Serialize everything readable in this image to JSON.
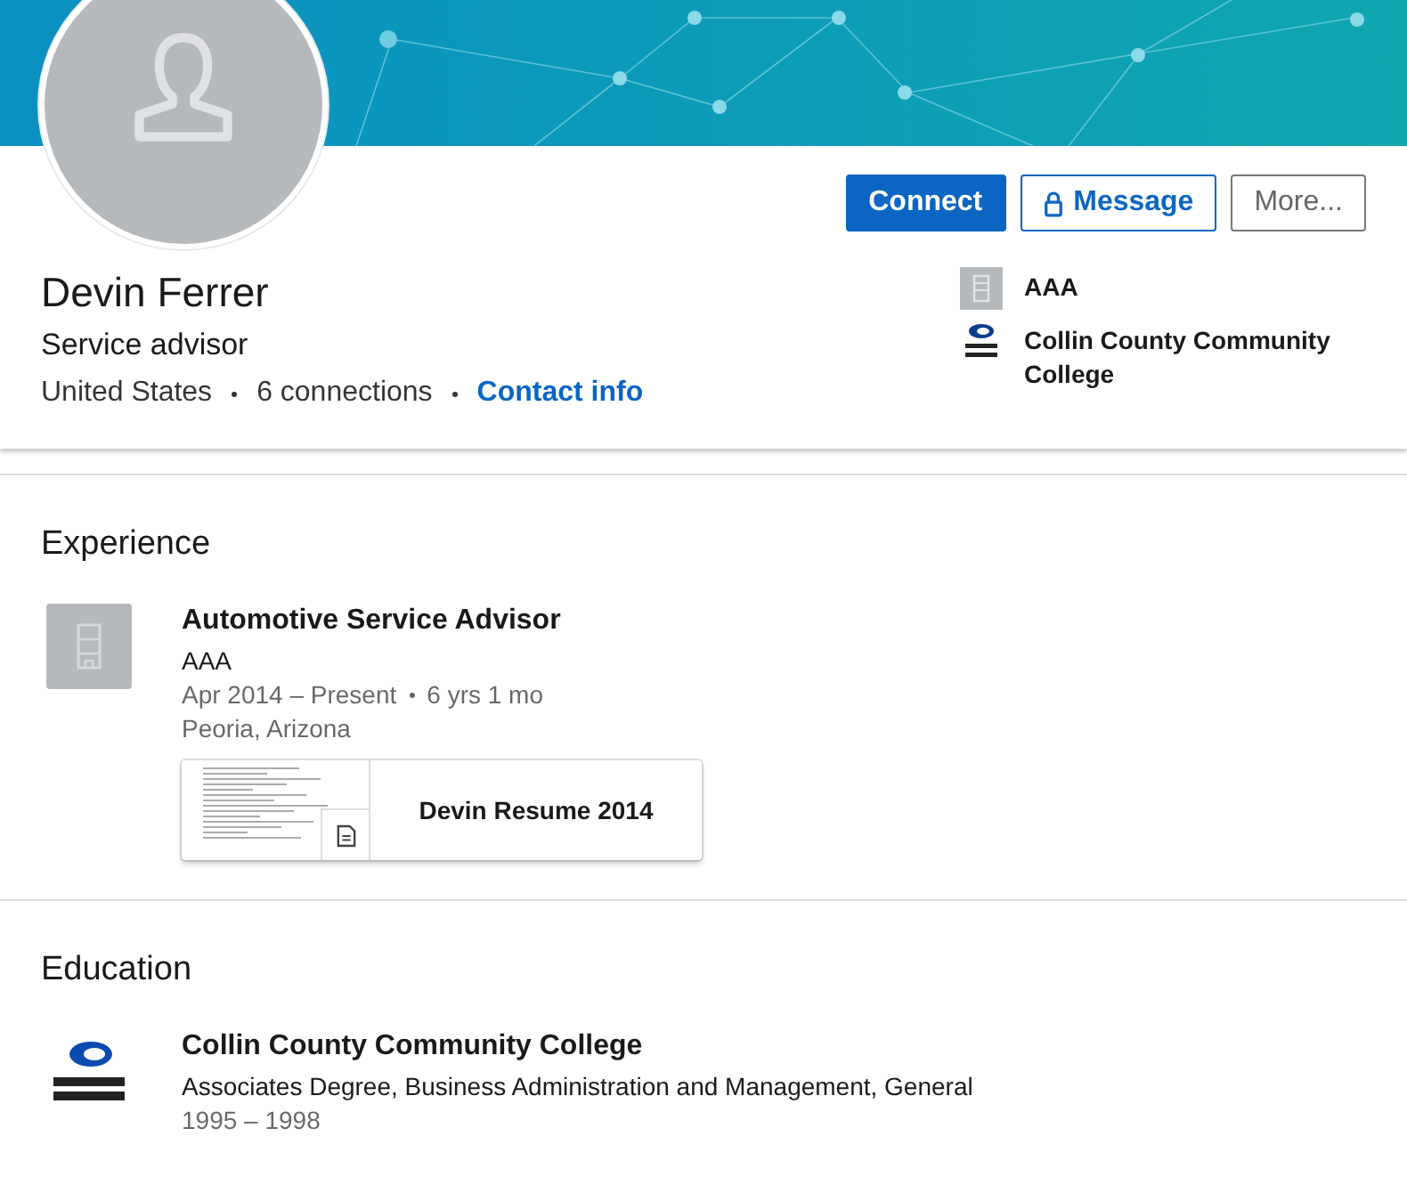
{
  "profile": {
    "name": "Devin Ferrer",
    "headline": "Service advisor",
    "location": "United States",
    "connections": "6 connections",
    "contact_link": "Contact info"
  },
  "actions": [
    {
      "label": "Connect",
      "kind": "primary"
    },
    {
      "label": "Message",
      "kind": "locked"
    },
    {
      "label": "More...",
      "kind": "plain"
    }
  ],
  "affiliations": [
    {
      "name": "AAA",
      "kind": "company"
    },
    {
      "name": "Collin County Community College",
      "kind": "school"
    }
  ],
  "experience": {
    "heading": "Experience",
    "items": [
      {
        "title": "Automotive Service Advisor",
        "company": "AAA",
        "dates": "Apr 2014 – Present",
        "duration": "6 yrs 1 mo",
        "location": "Peoria, Arizona",
        "attachment": "Devin Resume 2014"
      }
    ]
  },
  "education": {
    "heading": "Education",
    "items": [
      {
        "school": "Collin County Community College",
        "degree": "Associates Degree, Business Administration and Management, General",
        "years": "1995 – 1998"
      }
    ]
  }
}
